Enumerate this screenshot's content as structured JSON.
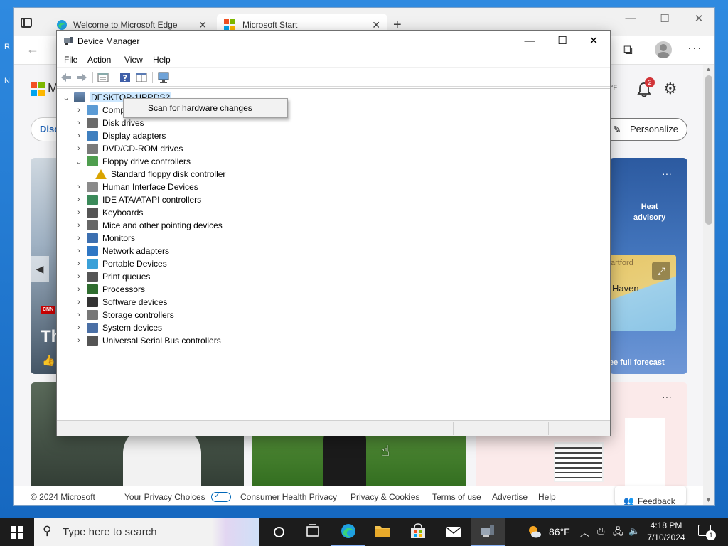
{
  "desktop": {
    "edge_letters": "R\n \n \nN"
  },
  "edge": {
    "tabs": [
      {
        "label": "Welcome to Microsoft Edge",
        "close": "✕"
      },
      {
        "label": "Microsoft Start",
        "close": "✕"
      }
    ],
    "new_tab": "+",
    "window_controls": {
      "minimize": "—",
      "maximize": "☐",
      "close": "✕"
    },
    "toolbar": {
      "back": "←",
      "collections": "⧉",
      "more": "···"
    }
  },
  "msn": {
    "logo_partial": "M",
    "discover_partial": "Disc",
    "temp_partial": "°F",
    "notification_count": "2",
    "personalize_label": "Personalize",
    "news_card": {
      "source_tag": "CNN",
      "headline_partial": "Th"
    },
    "weather_card": {
      "advisory": "Heat\nadvisory",
      "map_city_top": "artford",
      "map_city": "Haven",
      "forecast_link": "ee full forecast"
    },
    "footer": {
      "copyright": "© 2024 Microsoft",
      "privacy_choices": "Your Privacy Choices",
      "consumer_health": "Consumer Health Privacy",
      "privacy_cookies": "Privacy & Cookies",
      "terms": "Terms of use",
      "advertise": "Advertise",
      "help": "Help",
      "feedback": "Feedback"
    }
  },
  "device_manager": {
    "title": "Device Manager",
    "menu": [
      "File",
      "Action",
      "View",
      "Help"
    ],
    "root": "DESKTOP-1IPRDS2",
    "context_menu": {
      "item": "Scan for hardware changes"
    },
    "tree": [
      {
        "label": "Computer",
        "expanded": false,
        "icon": "computer-icon"
      },
      {
        "label": "Disk drives",
        "expanded": false,
        "icon": "disk-drive-icon"
      },
      {
        "label": "Display adapters",
        "expanded": false,
        "icon": "display-adapter-icon"
      },
      {
        "label": "DVD/CD-ROM drives",
        "expanded": false,
        "icon": "dvd-drive-icon"
      },
      {
        "label": "Floppy drive controllers",
        "expanded": true,
        "icon": "floppy-controller-icon"
      },
      {
        "label": "Standard floppy disk controller",
        "child": true,
        "warning": true,
        "icon": "warning-device-icon"
      },
      {
        "label": "Human Interface Devices",
        "expanded": false,
        "icon": "hid-icon"
      },
      {
        "label": "IDE ATA/ATAPI controllers",
        "expanded": false,
        "icon": "ide-controller-icon"
      },
      {
        "label": "Keyboards",
        "expanded": false,
        "icon": "keyboard-icon"
      },
      {
        "label": "Mice and other pointing devices",
        "expanded": false,
        "icon": "mouse-icon"
      },
      {
        "label": "Monitors",
        "expanded": false,
        "icon": "monitor-icon"
      },
      {
        "label": "Network adapters",
        "expanded": false,
        "icon": "network-adapter-icon"
      },
      {
        "label": "Portable Devices",
        "expanded": false,
        "icon": "portable-device-icon"
      },
      {
        "label": "Print queues",
        "expanded": false,
        "icon": "printer-icon"
      },
      {
        "label": "Processors",
        "expanded": false,
        "icon": "processor-icon"
      },
      {
        "label": "Software devices",
        "expanded": false,
        "icon": "software-device-icon"
      },
      {
        "label": "Storage controllers",
        "expanded": false,
        "icon": "storage-controller-icon"
      },
      {
        "label": "System devices",
        "expanded": false,
        "icon": "system-device-icon"
      },
      {
        "label": "Universal Serial Bus controllers",
        "expanded": false,
        "icon": "usb-icon"
      }
    ]
  },
  "taskbar": {
    "search_placeholder": "Type here to search",
    "weather_temp": "86°F",
    "time": "4:18 PM",
    "date": "7/10/2024",
    "notification_count": "1"
  },
  "colors": {
    "accent": "#0067b8",
    "selection": "#cde8ff",
    "taskbar": "#1c1c1c"
  }
}
